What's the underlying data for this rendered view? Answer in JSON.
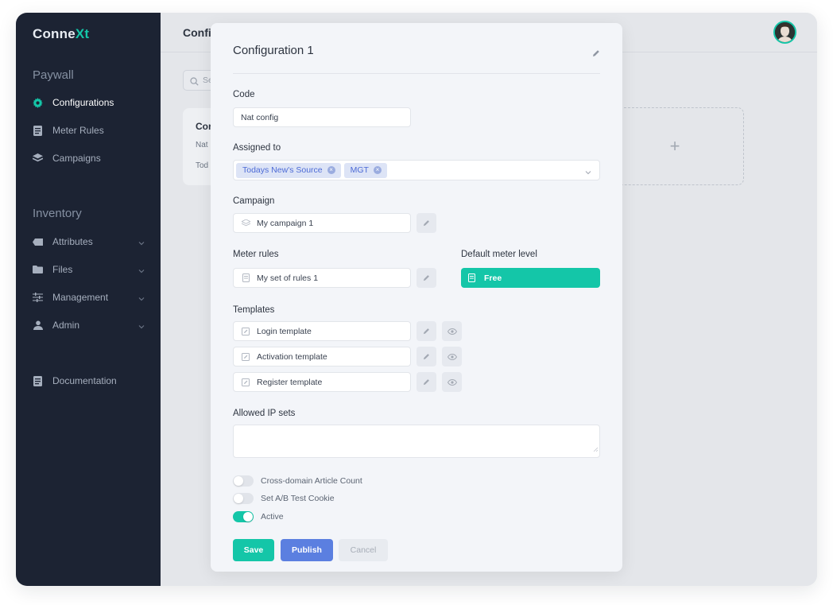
{
  "app": {
    "logo_main": "Conne",
    "logo_accent": "Xt"
  },
  "sidebar": {
    "paywall_title": "Paywall",
    "paywall_items": [
      {
        "label": "Configurations"
      },
      {
        "label": "Meter Rules"
      },
      {
        "label": "Campaigns"
      }
    ],
    "inventory_title": "Inventory",
    "inventory_items": [
      {
        "label": "Attributes"
      },
      {
        "label": "Files"
      },
      {
        "label": "Management"
      },
      {
        "label": "Admin"
      }
    ],
    "documentation_label": "Documentation"
  },
  "header": {
    "title": "Confi"
  },
  "background": {
    "search_placeholder": "Se",
    "card_title": "Cor",
    "card_line1": "Nat",
    "card_line2": "Tod",
    "add_symbol": "+"
  },
  "modal": {
    "title": "Configuration 1",
    "code_label": "Code",
    "code_value": "Nat config",
    "assigned_label": "Assigned to",
    "assigned_tags": [
      {
        "label": "Todays New's Source"
      },
      {
        "label": "MGT"
      }
    ],
    "campaign_label": "Campaign",
    "campaign_value": "My campaign 1",
    "meter_rules_label": "Meter rules",
    "meter_rules_value": "My set of rules 1",
    "default_meter_label": "Default meter level",
    "default_meter_value": "Free",
    "templates_label": "Templates",
    "templates": [
      {
        "label": "Login template"
      },
      {
        "label": "Activation template"
      },
      {
        "label": "Register template"
      }
    ],
    "allowed_ip_label": "Allowed IP sets",
    "toggles": [
      {
        "label": "Cross-domain Article Count",
        "on": false
      },
      {
        "label": "Set A/B Test Cookie",
        "on": false
      },
      {
        "label": "Active",
        "on": true
      }
    ],
    "buttons": {
      "save": "Save",
      "publish": "Publish",
      "cancel": "Cancel"
    }
  },
  "colors": {
    "sidebar_bg": "#1c2333",
    "accent_green": "#14c6a8",
    "accent_blue": "#5b7fe0",
    "tag_bg": "#dde4f6"
  }
}
